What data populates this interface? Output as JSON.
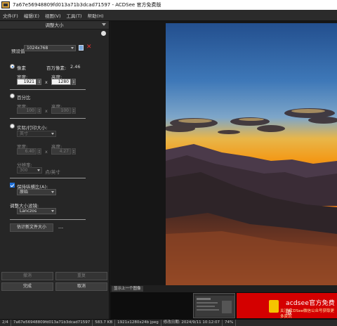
{
  "window": {
    "title": "7a67e56948809fd013a71b3dcad71597 - ACDSee 官方免费版"
  },
  "menu": [
    "文件(F)",
    "编辑(E)",
    "视图(V)",
    "工具(T)",
    "帮助(H)"
  ],
  "panel": {
    "title": "调整大小",
    "preset_label": "预设值",
    "preset_value": "1024x768",
    "pixels": {
      "label": "像素",
      "megapixels_label": "百万像素:",
      "megapixels_value": "2.46",
      "width_label": "宽度:",
      "height_label": "高度:",
      "width_value": "1921",
      "height_value": "1280",
      "times": "x"
    },
    "percent": {
      "label": "百分比",
      "width_label": "宽度:",
      "height_label": "高度:",
      "width_value": "100",
      "height_value": "100",
      "times": "x"
    },
    "print": {
      "label": "实际/打印大小:",
      "unit": "英寸",
      "width_label": "宽度:",
      "height_label": "高度:",
      "width_value": "6.40",
      "height_value": "4.27",
      "times": "x",
      "resolution_label": "分辨率:",
      "resolution_value": "300",
      "resolution_unit": "点/英寸"
    },
    "aspect": {
      "label": "保持纵横比(A):",
      "value": "原始"
    },
    "filter": {
      "label": "调整大小滤镜:",
      "value": "Lanczos"
    },
    "estimate_button": "估计新文件大小",
    "estimate_value": "---",
    "buttons": {
      "cancel_top": "撤消",
      "redo": "重复",
      "done": "完成",
      "cancel": "取消"
    }
  },
  "viewer": {
    "nav_label": "显示上一个图像"
  },
  "ad": {
    "brand": "acdsee官方免费版",
    "slogan": "关注ACDSee微信公众号获取更多资讯"
  },
  "status": {
    "index": "2/4",
    "filename": "7a67e56948809fd013a71b3dcad71597",
    "filesize": "583.7 KB",
    "dims": "1921x1280x24b jpeg",
    "modified": "修改日期: 2024/9/11 10:12:07",
    "zoom": "74%"
  },
  "colors": {
    "accent": "#1e6fd9",
    "ad_red": "#d40000",
    "sky_top": "#3b6fb0",
    "sunset": "#f2a019"
  }
}
